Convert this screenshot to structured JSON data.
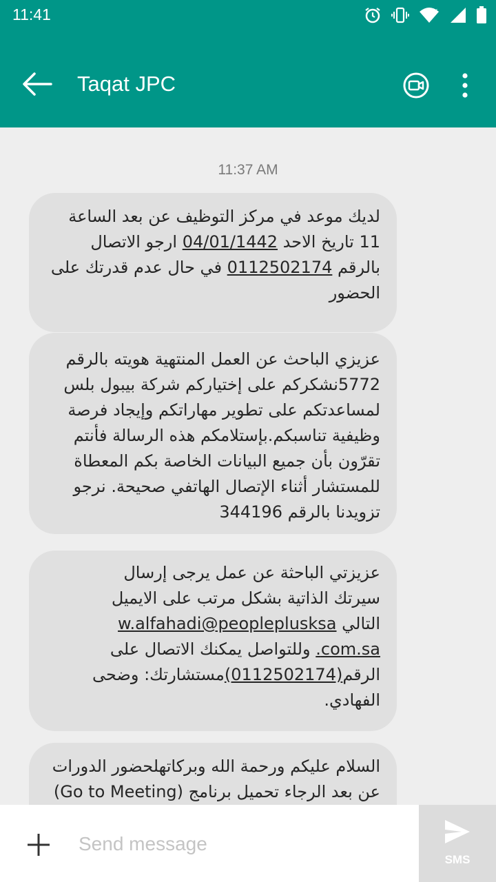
{
  "status_bar": {
    "time": "11:41"
  },
  "header": {
    "title": "Taqat JPC"
  },
  "thread": {
    "timestamp": "11:37 AM",
    "messages": [
      {
        "l1": "لديك موعد في مركز التوظيف عن بعد  الساعة",
        "l2a": "11 تاريخ  الاحد ",
        "l2_date": "04/01/1442",
        "l2b": " ارجو الاتصال",
        "l3a": "بالرقم ",
        "l3_phone": "0112502174",
        "l3b": " في حال عدم قدرتك على",
        "l4": "الحضور"
      },
      {
        "l1": "عزيزي الباحث عن العمل المنتهية هويته بالرقم",
        "l2": "5772نشكركم على إختياركم شركة بيبول بلس",
        "l3": "لمساعدتكم على تطوير مهاراتكم وإيجاد فرصة",
        "l4": "وظيفية تناسبكم.بإستلامكم هذه الرسالة فأنتم",
        "l5": "تقرّون بأن جميع البيانات الخاصة بكم المعطاة",
        "l6": "للمستشار أثناء الإتصال الهاتفي صحيحة. نرجو",
        "l7": "تزويدنا بالرقم  344196"
      },
      {
        "l1": "عزيزتي الباحثة عن عمل يرجى إرسال",
        "l2": "سيرتك الذاتية بشكل مرتب على الايميل",
        "l3a": "التالي ",
        "l3_email": "w.alfahadi@peopleplusksa",
        "l4_email": "com.sa.",
        "l4b": " وللتواصل يمكنك الاتصال على",
        "l5a": "الرقم",
        "l5_phone": "(0112502174)",
        "l5b": "مستشارتك: وضحى",
        "l6": "الفهادي."
      },
      {
        "l1": "السلام عليكم ورحمة الله وبركاتهلحضور الدورات",
        "l2": "عن بعد الرجاء تحميل برنامج (Go to Meeting)"
      }
    ]
  },
  "composer": {
    "placeholder": "Send message",
    "send_label": "SMS"
  },
  "colors": {
    "primary": "#009688",
    "bubble": "#e0e0e0",
    "background": "#eeeeee"
  }
}
